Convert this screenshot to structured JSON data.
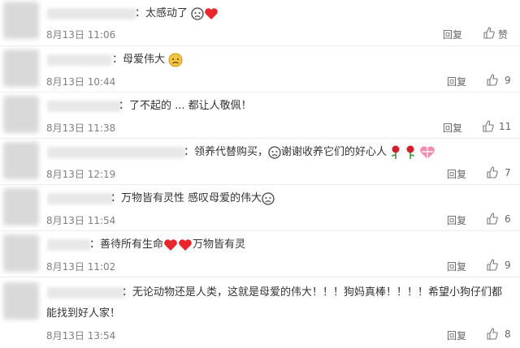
{
  "reply_label": "回复",
  "like_label": "赞",
  "comments": [
    {
      "prefix": "：",
      "text": "太感动了",
      "date": "8月13日 11:06",
      "likes": "赞"
    },
    {
      "prefix": "：",
      "text": "母爱伟大",
      "date": "8月13日 10:44",
      "likes": "9"
    },
    {
      "prefix": "：",
      "text": "了不起的 ... 都让人敬佩！",
      "date": "8月13日 11:38",
      "likes": "11"
    },
    {
      "prefix": "：",
      "text": "领养代替购买，",
      "text2": "谢谢收养它们的好心人",
      "date": "8月13日 12:19",
      "likes": "7"
    },
    {
      "prefix": "：",
      "text": "万物皆有灵性 感叹母爱的伟大",
      "date": "8月13日 11:54",
      "likes": "6"
    },
    {
      "prefix": "：",
      "text": "善待所有生命",
      "text2": "万物皆有灵",
      "date": "8月13日 11:02",
      "likes": "9"
    },
    {
      "prefix": "：",
      "text": "无论动物还是人类，这就是母爱的伟大！！！狗妈真棒！！！！希望小狗仔们都",
      "text_line2": "能找到好人家！",
      "date": "8月13日 13:54",
      "likes": "8"
    }
  ]
}
